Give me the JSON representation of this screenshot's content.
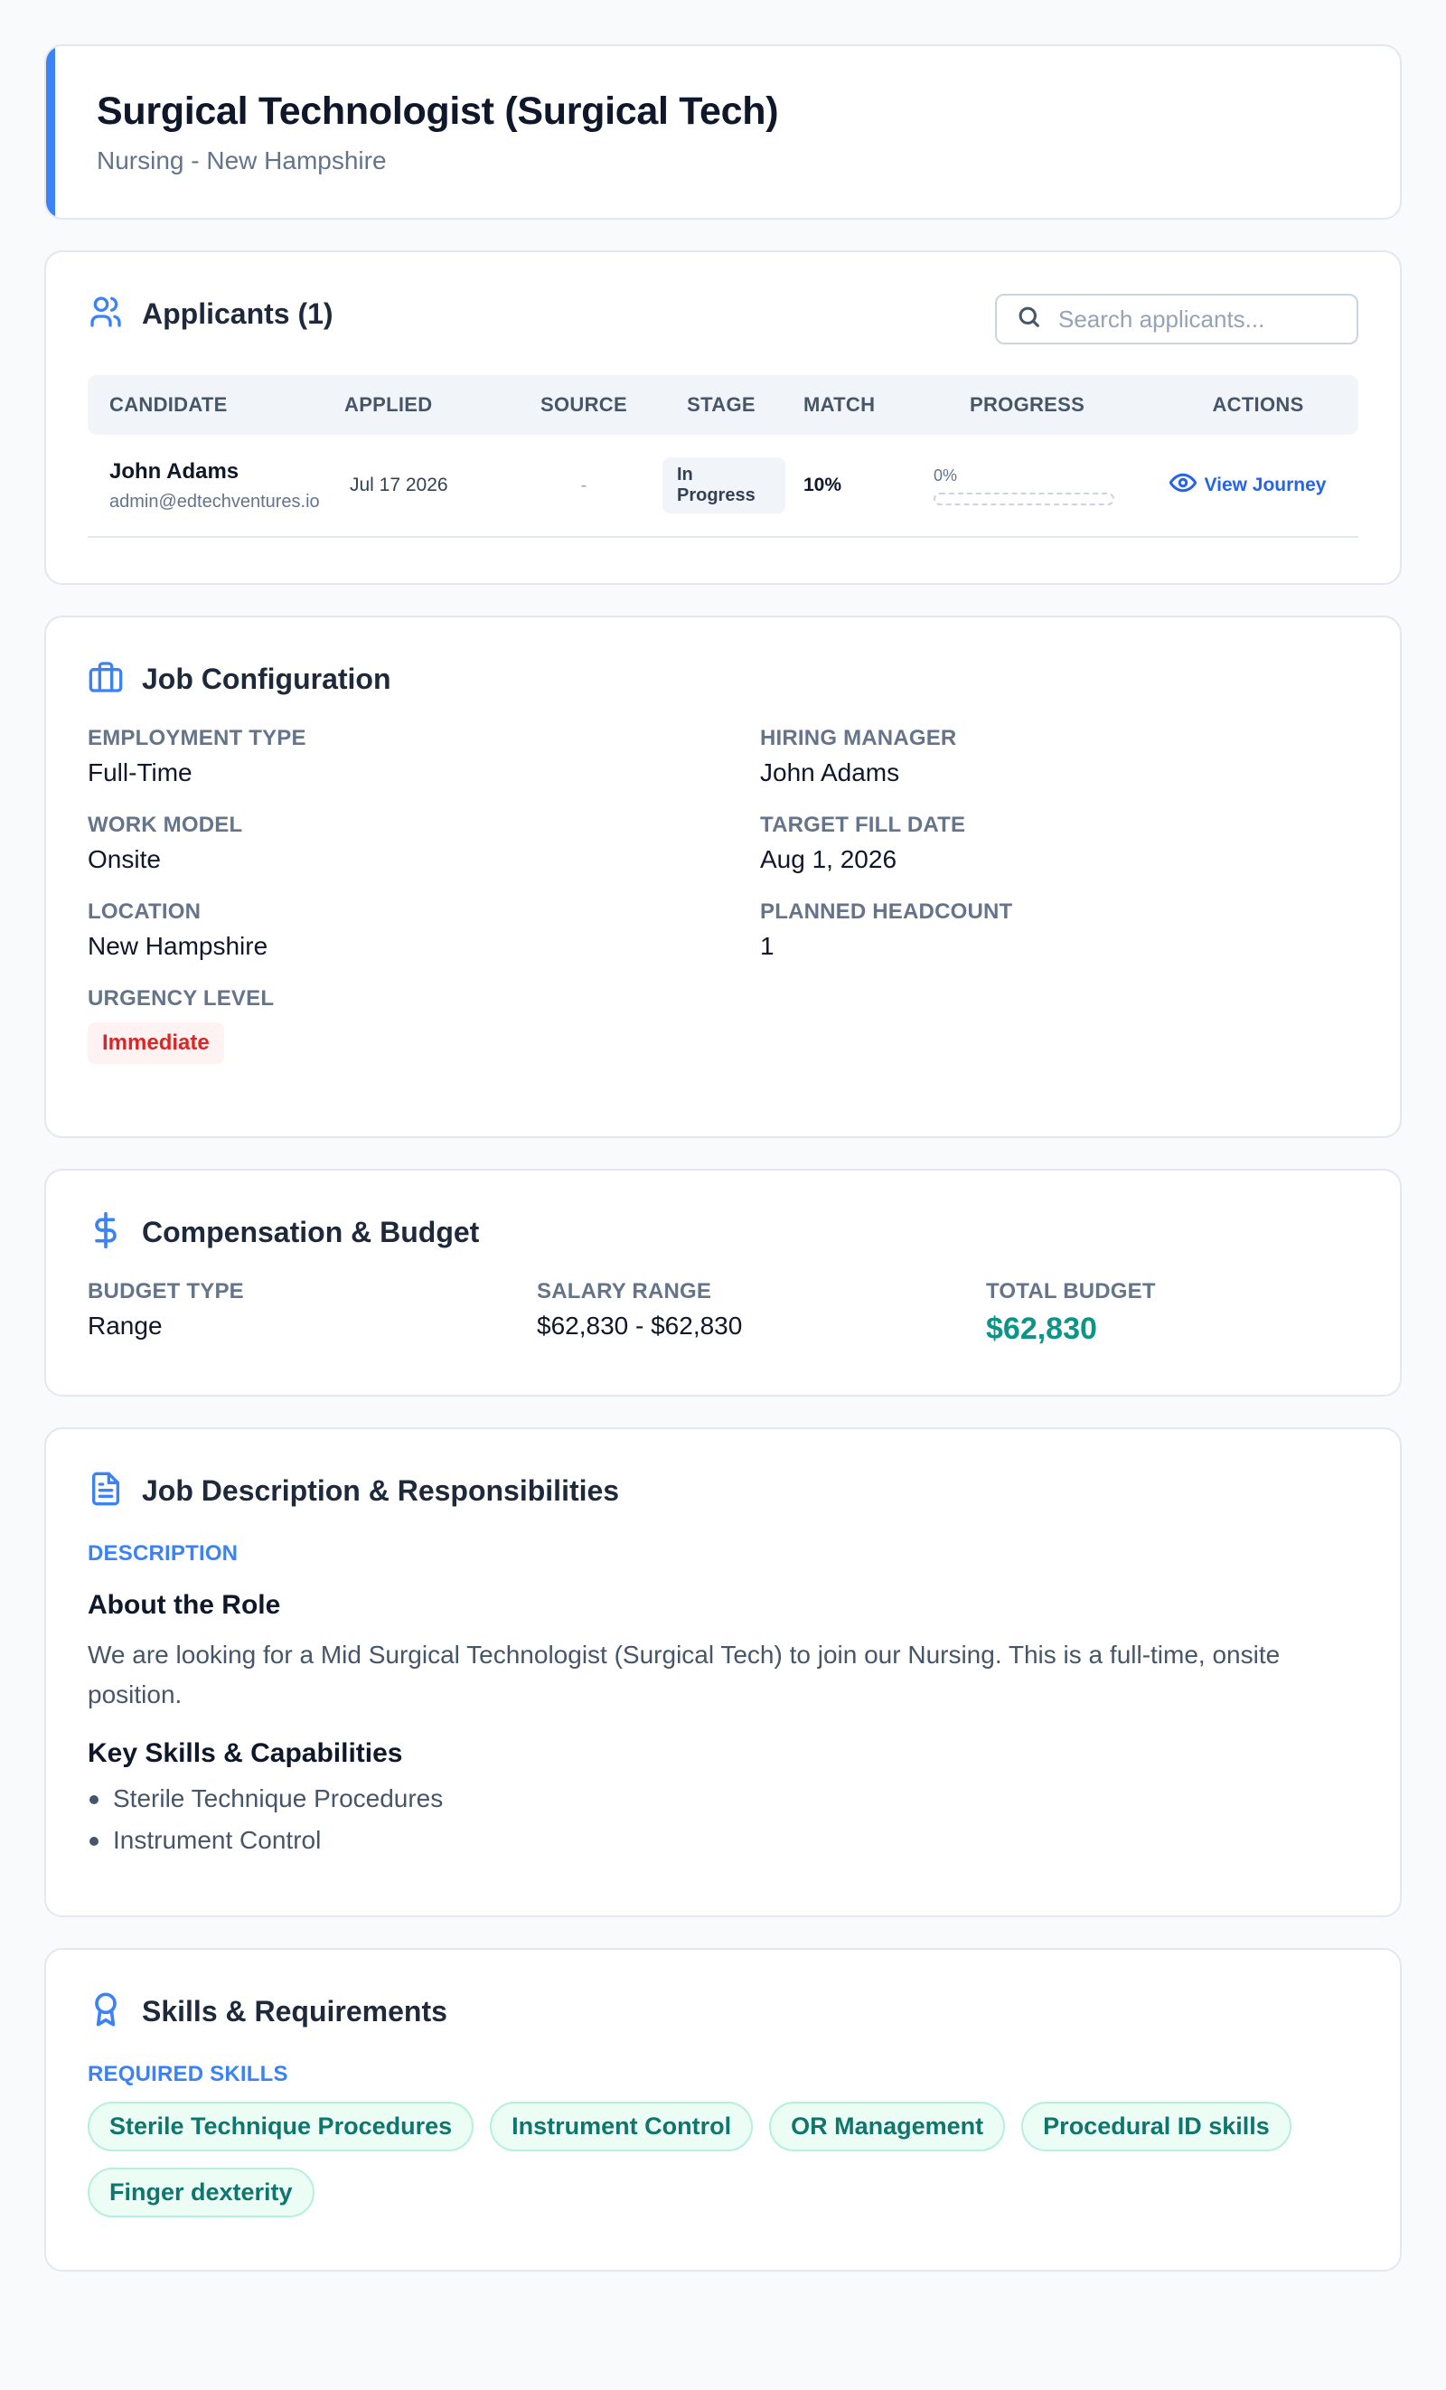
{
  "header": {
    "title": "Surgical Technologist (Surgical Tech)",
    "subtitle": "Nursing - New Hampshire"
  },
  "applicants": {
    "title": "Applicants (1)",
    "search_placeholder": "Search applicants...",
    "columns": [
      "CANDIDATE",
      "APPLIED",
      "SOURCE",
      "STAGE",
      "MATCH",
      "PROGRESS",
      "ACTIONS"
    ],
    "rows": [
      {
        "name": "John Adams",
        "email": "admin@edtechventures.io",
        "applied": "Jul 17 2026",
        "source": "-",
        "stage": "In Progress",
        "match": "10%",
        "progress_label": "0%",
        "progress_fraction": 0,
        "action": "View Journey"
      }
    ]
  },
  "config": {
    "title": "Job Configuration",
    "employment_type_label": "EMPLOYMENT TYPE",
    "employment_type": "Full-Time",
    "hiring_manager_label": "HIRING MANAGER",
    "hiring_manager": "John Adams",
    "work_model_label": "WORK MODEL",
    "work_model": "Onsite",
    "target_fill_label": "TARGET FILL DATE",
    "target_fill": "Aug 1, 2026",
    "location_label": "LOCATION",
    "location": "New Hampshire",
    "headcount_label": "PLANNED HEADCOUNT",
    "headcount": "1",
    "urgency_label": "URGENCY LEVEL",
    "urgency": "Immediate"
  },
  "compensation": {
    "title": "Compensation & Budget",
    "budget_type_label": "BUDGET TYPE",
    "budget_type": "Range",
    "salary_range_label": "SALARY RANGE",
    "salary_range": "$62,830 - $62,830",
    "total_budget_label": "TOTAL BUDGET",
    "total_budget": "$62,830"
  },
  "description": {
    "title": "Job Description & Responsibilities",
    "label": "DESCRIPTION",
    "about_heading": "About the Role",
    "about_text": "We are looking for a Mid Surgical Technologist (Surgical Tech) to join our Nursing. This is a full-time, onsite position.",
    "skills_heading": "Key Skills & Capabilities",
    "skills": [
      "Sterile Technique Procedures",
      "Instrument Control"
    ]
  },
  "skills": {
    "title": "Skills & Requirements",
    "label": "REQUIRED SKILLS",
    "chips": [
      "Sterile Technique Procedures",
      "Instrument Control",
      "OR Management",
      "Procedural ID skills",
      "Finger dexterity"
    ]
  },
  "colors": {
    "accent": "#3b82f6",
    "urgent": "#dc2626",
    "budget": "#0d9488",
    "chip_text": "#0f766e"
  }
}
